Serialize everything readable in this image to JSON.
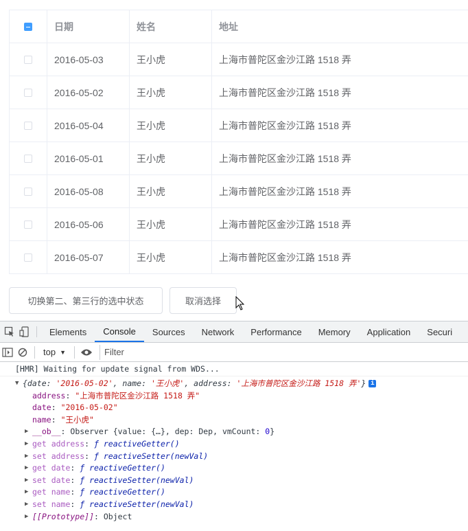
{
  "table": {
    "headers": {
      "date": "日期",
      "name": "姓名",
      "address": "地址"
    },
    "rows": [
      {
        "date": "2016-05-03",
        "name": "王小虎",
        "address": "上海市普陀区金沙江路 1518 弄"
      },
      {
        "date": "2016-05-02",
        "name": "王小虎",
        "address": "上海市普陀区金沙江路 1518 弄"
      },
      {
        "date": "2016-05-04",
        "name": "王小虎",
        "address": "上海市普陀区金沙江路 1518 弄"
      },
      {
        "date": "2016-05-01",
        "name": "王小虎",
        "address": "上海市普陀区金沙江路 1518 弄"
      },
      {
        "date": "2016-05-08",
        "name": "王小虎",
        "address": "上海市普陀区金沙江路 1518 弄"
      },
      {
        "date": "2016-05-06",
        "name": "王小虎",
        "address": "上海市普陀区金沙江路 1518 弄"
      },
      {
        "date": "2016-05-07",
        "name": "王小虎",
        "address": "上海市普陀区金沙江路 1518 弄"
      }
    ]
  },
  "buttons": {
    "toggle": "切换第二、第三行的选中状态",
    "clear": "取消选择"
  },
  "devtools": {
    "tabs": [
      "Elements",
      "Console",
      "Sources",
      "Network",
      "Performance",
      "Memory",
      "Application",
      "Securi"
    ],
    "active_tab": "Console",
    "context": "top",
    "filter_placeholder": "Filter",
    "console": {
      "hmr": "[HMR] Waiting for update signal from WDS...",
      "obj_summary": {
        "open": "{date: ",
        "date_val": "'2016-05-02'",
        "name_lbl": ", name: ",
        "name_val": "'王小虎'",
        "addr_lbl": ", address: ",
        "addr_val": "'上海市普陀区金沙江路 1518 弄'",
        "close": "}",
        "info": "i"
      },
      "props": [
        {
          "key": "address",
          "value": "\"上海市普陀区金沙江路 1518 弄\""
        },
        {
          "key": "date",
          "value": "\"2016-05-02\""
        },
        {
          "key": "name",
          "value": "\"王小虎\""
        }
      ],
      "ob": {
        "key": "__ob__",
        "pre": ": Observer {value: {…}, dep: Dep, vmCount: ",
        "num": "0",
        "post": "}"
      },
      "accessors": [
        {
          "key": "get address",
          "fn": "ƒ reactiveGetter()"
        },
        {
          "key": "set address",
          "fn": "ƒ reactiveSetter(newVal)"
        },
        {
          "key": "get date",
          "fn": "ƒ reactiveGetter()"
        },
        {
          "key": "set date",
          "fn": "ƒ reactiveSetter(newVal)"
        },
        {
          "key": "get name",
          "fn": "ƒ reactiveGetter()"
        },
        {
          "key": "set name",
          "fn": "ƒ reactiveSetter(newVal)"
        }
      ],
      "proto": {
        "key": "[[Prototype]]",
        "value": ": Object"
      }
    }
  },
  "colors": {
    "accent": "#409eff",
    "devtools_active": "#1a73e8",
    "string": "#c41a16",
    "key": "#881280"
  }
}
